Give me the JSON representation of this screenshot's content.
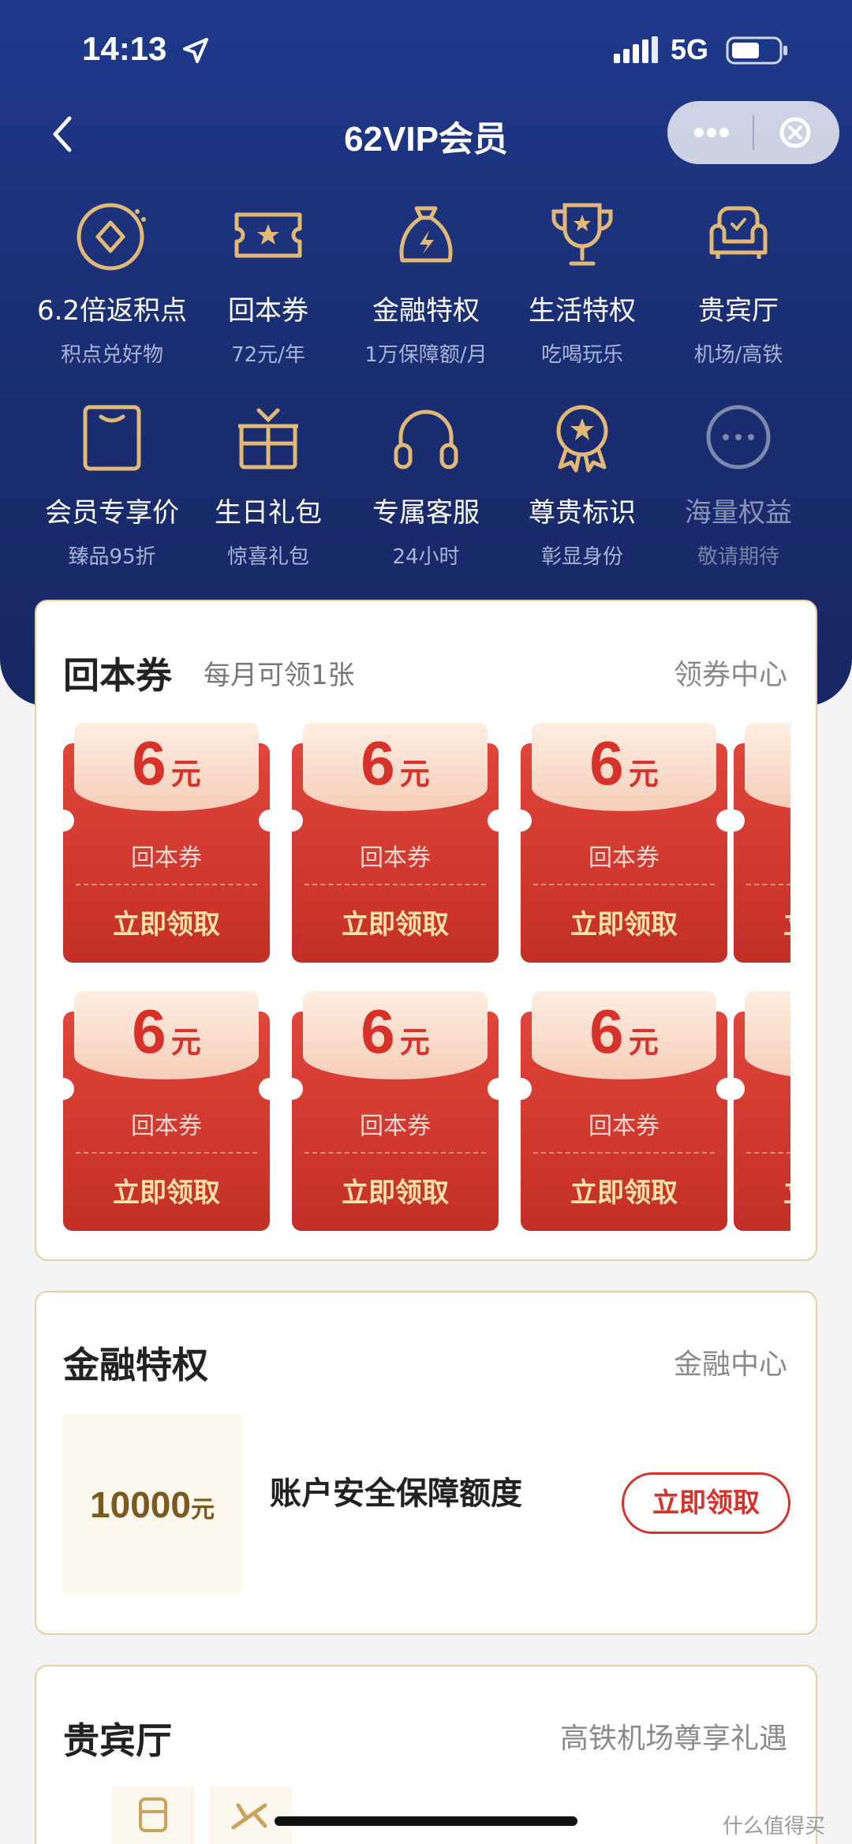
{
  "status": {
    "time": "14:13",
    "network": "5G"
  },
  "nav": {
    "title": "62VIP会员"
  },
  "benefits": [
    {
      "title": "6.2倍返积点",
      "sub": "积点兑好物",
      "icon": "points-icon"
    },
    {
      "title": "回本券",
      "sub": "72元/年",
      "icon": "ticket-icon"
    },
    {
      "title": "金融特权",
      "sub": "1万保障额/月",
      "icon": "money-bag-icon"
    },
    {
      "title": "生活特权",
      "sub": "吃喝玩乐",
      "icon": "trophy-icon"
    },
    {
      "title": "贵宾厅",
      "sub": "机场/高铁",
      "icon": "sofa-icon"
    },
    {
      "title": "会员专享价",
      "sub": "臻品95折",
      "icon": "tag-icon"
    },
    {
      "title": "生日礼包",
      "sub": "惊喜礼包",
      "icon": "gift-icon"
    },
    {
      "title": "专属客服",
      "sub": "24小时",
      "icon": "headset-icon"
    },
    {
      "title": "尊贵标识",
      "sub": "彰显身份",
      "icon": "badge-icon"
    },
    {
      "title": "海量权益",
      "sub": "敬请期待",
      "icon": "more-icon"
    }
  ],
  "coupon_card": {
    "title": "回本券",
    "subtitle": "每月可领1张",
    "link": "领券中心",
    "coupons": [
      {
        "amount": "6",
        "unit": "元",
        "name": "回本券",
        "action": "立即领取"
      },
      {
        "amount": "6",
        "unit": "元",
        "name": "回本券",
        "action": "立即领取"
      },
      {
        "amount": "6",
        "unit": "元",
        "name": "回本券",
        "action": "立即领取"
      },
      {
        "amount": "6",
        "unit": "元",
        "name": "回本券",
        "action": "立即领取"
      },
      {
        "amount": "6",
        "unit": "元",
        "name": "回本券",
        "action": "立即领取"
      },
      {
        "amount": "6",
        "unit": "元",
        "name": "回本券",
        "action": "立即领取"
      }
    ]
  },
  "finance_card": {
    "title": "金融特权",
    "link": "金融中心",
    "amount": "10000",
    "unit": "元",
    "desc": "账户安全保障额度",
    "action": "立即领取"
  },
  "vip_card": {
    "title": "贵宾厅",
    "link": "高铁机场尊享礼遇"
  },
  "watermark": "什么值得买",
  "colors": {
    "hero": "#1f3a8c",
    "accent_red": "#d6322a",
    "gold": "#e6cfa0"
  }
}
